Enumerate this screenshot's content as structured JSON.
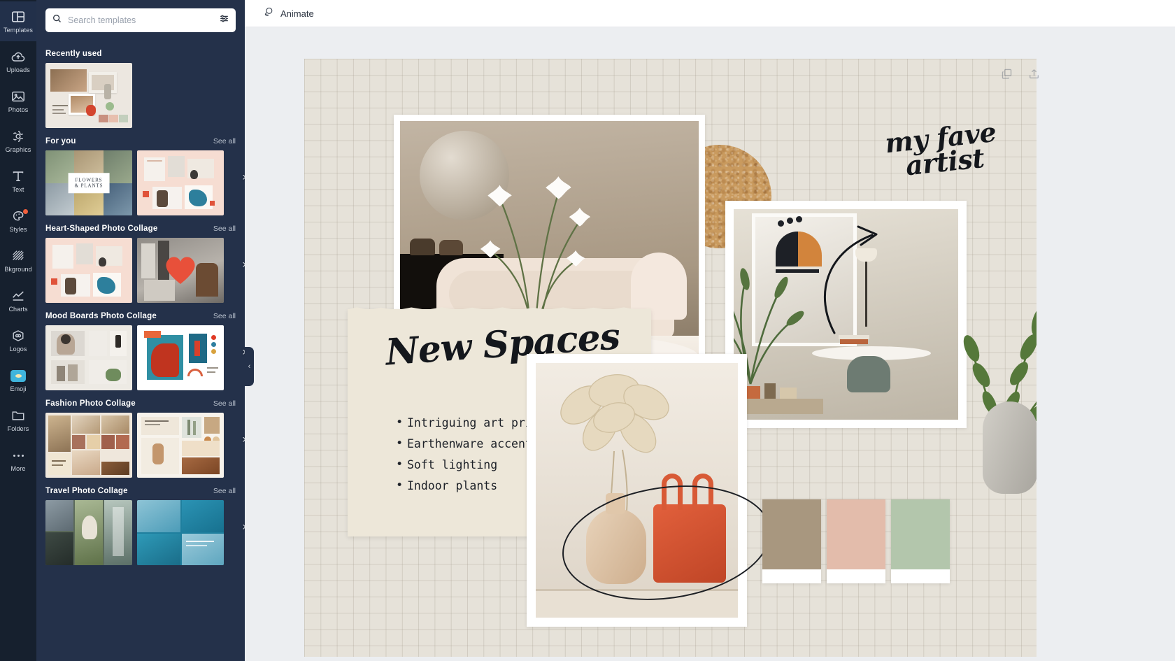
{
  "rail": {
    "items": [
      {
        "label": "Templates",
        "icon": "templates-icon",
        "active": true,
        "badge": false
      },
      {
        "label": "Uploads",
        "icon": "upload-cloud-icon",
        "active": false,
        "badge": false
      },
      {
        "label": "Photos",
        "icon": "photos-icon",
        "active": false,
        "badge": false
      },
      {
        "label": "Graphics",
        "icon": "graphics-icon",
        "active": false,
        "badge": false
      },
      {
        "label": "Text",
        "icon": "text-icon",
        "active": false,
        "badge": false
      },
      {
        "label": "Styles",
        "icon": "styles-palette-icon",
        "active": false,
        "badge": true
      },
      {
        "label": "Bkground",
        "icon": "background-icon",
        "active": false,
        "badge": false
      },
      {
        "label": "Charts",
        "icon": "charts-icon",
        "active": false,
        "badge": false
      },
      {
        "label": "Logos",
        "icon": "logos-icon",
        "active": false,
        "badge": false
      },
      {
        "label": "Emoji",
        "icon": "emoji-icon",
        "active": false,
        "badge": false
      },
      {
        "label": "Folders",
        "icon": "folder-icon",
        "active": false,
        "badge": false
      },
      {
        "label": "More",
        "icon": "more-dots-icon",
        "active": false,
        "badge": false
      }
    ]
  },
  "search": {
    "placeholder": "Search templates",
    "value": "",
    "icon": "search-icon",
    "filter_icon": "filter-sliders-icon"
  },
  "panel": {
    "collapse_handle": "‹",
    "see_all_label": "See all",
    "sections": [
      {
        "title": "Recently used",
        "has_see_all": false,
        "has_arrow": false
      },
      {
        "title": "For you",
        "has_see_all": true,
        "has_arrow": true
      },
      {
        "title": "Heart-Shaped Photo Collage",
        "has_see_all": true,
        "has_arrow": true
      },
      {
        "title": "Mood Boards Photo Collage",
        "has_see_all": true,
        "has_arrow": true
      },
      {
        "title": "Fashion Photo Collage",
        "has_see_all": true,
        "has_arrow": true
      },
      {
        "title": "Travel Photo Collage",
        "has_see_all": true,
        "has_arrow": true
      }
    ],
    "thumb_text": {
      "flowers_plants_line1": "FLOWERS",
      "flowers_plants_line2": "& PLANTS"
    }
  },
  "topbar": {
    "animate_label": "Animate",
    "animate_icon": "animate-circle-icon"
  },
  "canvas_tools": [
    {
      "name": "duplicate-page-icon",
      "label": "Duplicate page"
    },
    {
      "name": "export-page-icon",
      "label": "Export page"
    }
  ],
  "design": {
    "title": "New Spaces",
    "annotation": {
      "line1": "my fave",
      "line2": "artist"
    },
    "bullets": [
      "Intriguing art prints",
      "Earthenware accent pieces",
      "Soft lighting",
      "Indoor plants"
    ],
    "palette": [
      {
        "name": "taupe",
        "hex": "#a8977f"
      },
      {
        "name": "blush",
        "hex": "#e3bcab"
      },
      {
        "name": "sage",
        "hex": "#b3c6ac"
      }
    ],
    "canvas_bg": "#e6e2d9"
  }
}
